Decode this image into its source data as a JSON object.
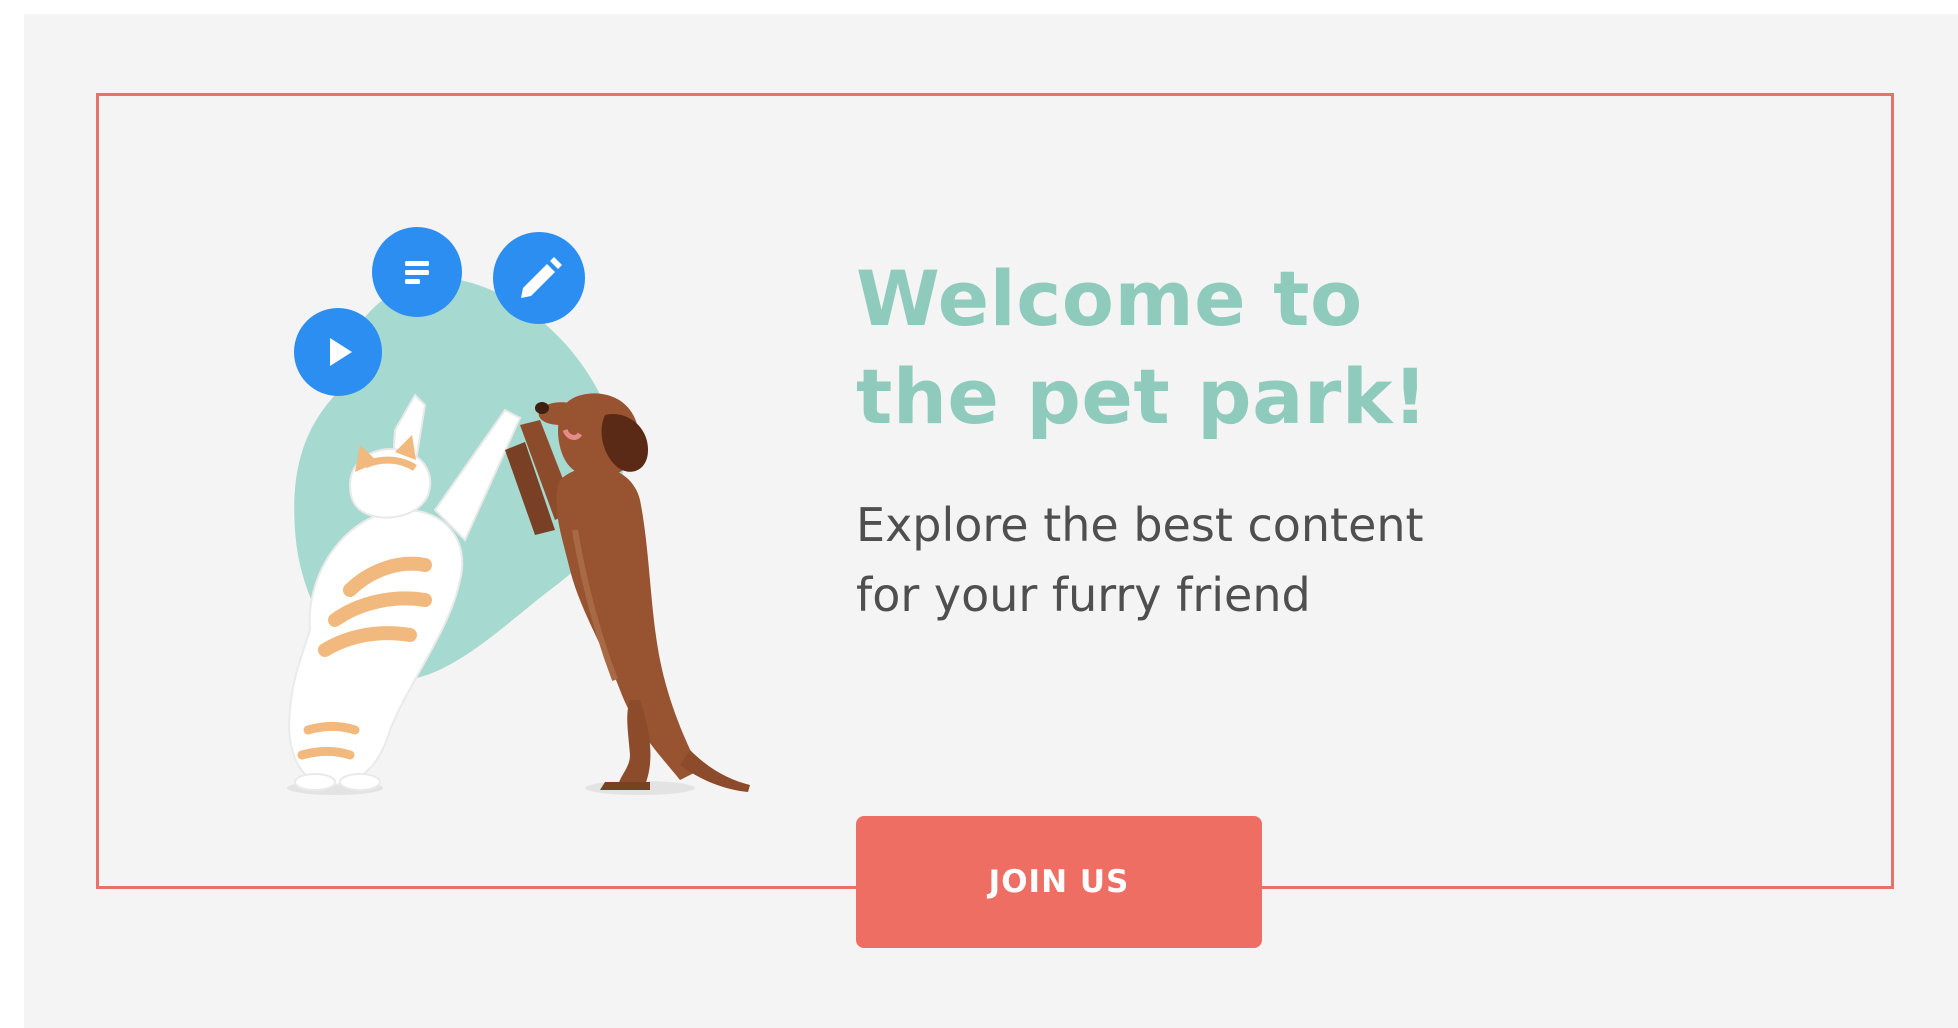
{
  "hero": {
    "headline_line1": "Welcome to",
    "headline_line2": "the pet park!",
    "subtitle_line1": "Explore the best content",
    "subtitle_line2": "for your furry friend",
    "cta_label": "JOIN US"
  },
  "illustration": {
    "floating_buttons": [
      {
        "icon": "play-icon"
      },
      {
        "icon": "text-lines-icon"
      },
      {
        "icon": "pencil-icon"
      }
    ],
    "subjects": [
      "cat-icon",
      "dog-icon"
    ]
  },
  "colors": {
    "frame_border": "#e5736a",
    "headline": "#8fcbbd",
    "subtitle": "#4f4f4f",
    "cta_background": "#ef6e63",
    "icon_buttons": "#2b8ef0",
    "blob": "#a6d9cf",
    "background": "#f4f4f4"
  }
}
